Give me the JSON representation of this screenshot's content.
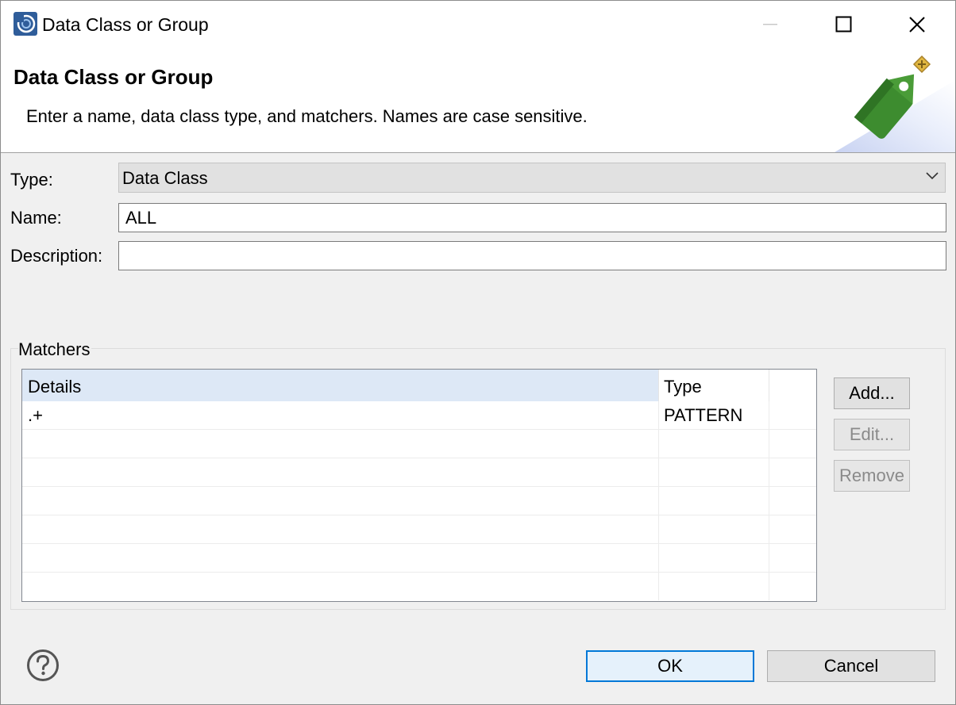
{
  "window": {
    "title": "Data Class or Group",
    "controls": [
      "minimize-icon",
      "maximize-icon",
      "close-icon"
    ]
  },
  "header": {
    "title": "Data Class or Group",
    "message": "Enter a name, data class type, and matchers. Names are case sensitive.",
    "image_icon": "green-tag-icon"
  },
  "form": {
    "type_label": "Type:",
    "type_value": "Data Class",
    "name_label": "Name:",
    "name_value": "ALL",
    "description_label": "Description:",
    "description_value": ""
  },
  "matchers": {
    "group_label": "Matchers",
    "columns": [
      "Details",
      "Type"
    ],
    "rows": [
      {
        "details": ".+",
        "type": "PATTERN"
      }
    ],
    "add_label": "Add...",
    "edit_label": "Edit...",
    "remove_label": "Remove"
  },
  "footer": {
    "ok_label": "OK",
    "cancel_label": "Cancel",
    "help_icon": "help-icon"
  },
  "colors": {
    "header_selected": "#dde8f6",
    "ok_border": "#0078d7",
    "tag_green": "#3a8a2e"
  }
}
